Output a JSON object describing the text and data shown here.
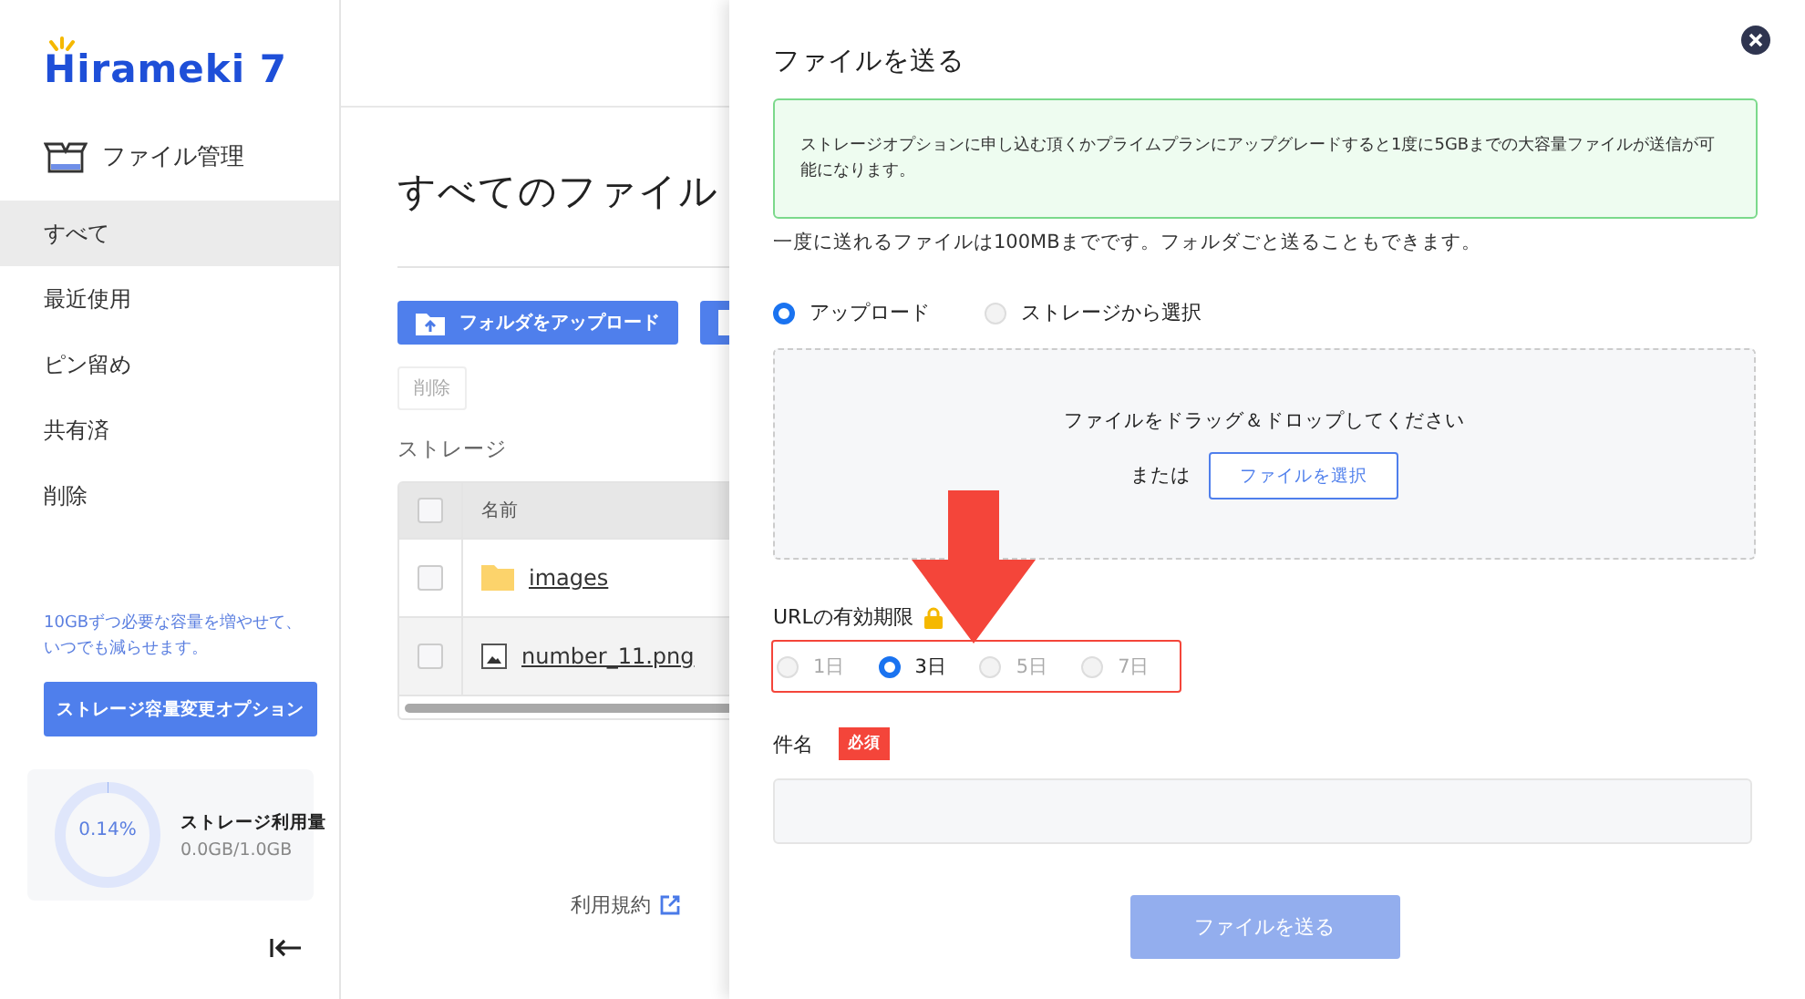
{
  "logo": {
    "text": "Hirameki 7"
  },
  "sidebar": {
    "heading": "ファイル管理",
    "items": [
      {
        "label": "すべて",
        "selected": true
      },
      {
        "label": "最近使用",
        "selected": false
      },
      {
        "label": "ピン留め",
        "selected": false
      },
      {
        "label": "共有済",
        "selected": false
      },
      {
        "label": "削除",
        "selected": false
      }
    ],
    "promo": "10GBずつ必要な容量を増やせて、いつでも減らせます。",
    "storage_button": "ストレージ容量変更オプション",
    "usage": {
      "percent": "0.14%",
      "level": 0.0014,
      "title": "ストレージ利用量",
      "amount": "0.0GB/1.0GB"
    }
  },
  "main": {
    "title": "すべてのファイル",
    "upload_button": "フォルダをアップロード",
    "delete_button": {
      "label": "削除",
      "disabled": true
    },
    "section": "ストレージ",
    "table": {
      "all_checked": false,
      "columns": [
        "名前"
      ],
      "rows": [
        {
          "name": "images",
          "kind": "folder",
          "checked": false,
          "selected": false
        },
        {
          "name": "number_11.png",
          "kind": "image",
          "checked": false,
          "selected": true
        }
      ]
    },
    "footer_link": "利用規約"
  },
  "dialog": {
    "title": "ファイルを送る",
    "notice": "ストレージオプションに申し込む頂くかプライムプランにアップグレードすると1度に5GBまでの大容量ファイルが送信が可能になります。",
    "limit_note": "一度に送れるファイルは100MBまでです。フォルダごと送ることもできます。",
    "source_options": [
      {
        "label": "アップロード",
        "selected": true
      },
      {
        "label": "ストレージから選択",
        "selected": false
      }
    ],
    "dropzone": {
      "text": "ファイルをドラッグ＆ドロップしてください",
      "or": "または",
      "button": "ファイルを選択"
    },
    "expiry": {
      "label": "URLの有効期限",
      "locked": true,
      "options": [
        {
          "label": "1日",
          "selected": false,
          "disabled": true
        },
        {
          "label": "3日",
          "selected": true,
          "disabled": false
        },
        {
          "label": "5日",
          "selected": false,
          "disabled": true
        },
        {
          "label": "7日",
          "selected": false,
          "disabled": true
        }
      ]
    },
    "subject": {
      "label": "件名",
      "badge": "必須"
    },
    "submit": {
      "label": "ファイルを送る",
      "disabled": true
    }
  },
  "annotations": {
    "arrow": true,
    "highlight_box": true
  }
}
